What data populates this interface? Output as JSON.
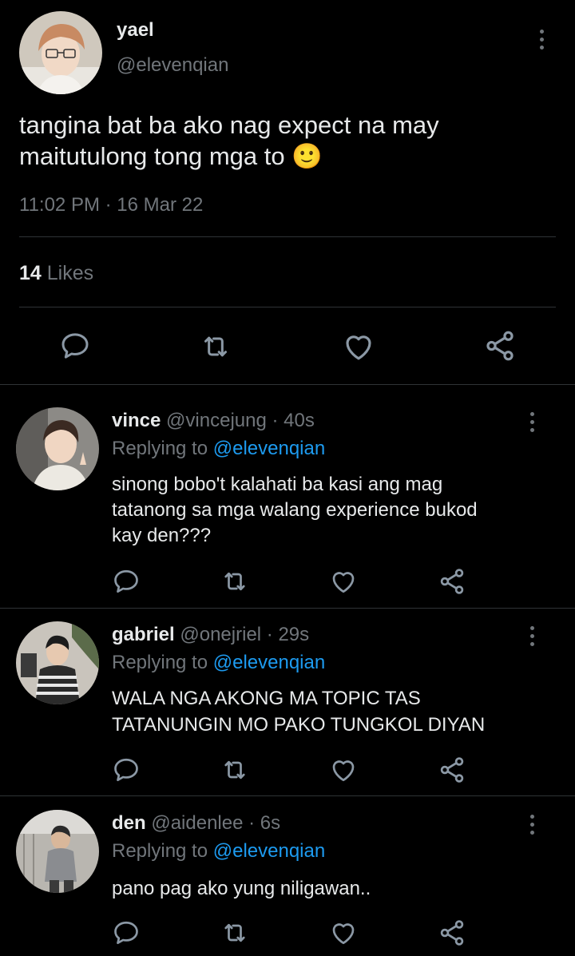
{
  "main_tweet": {
    "display_name": "yael",
    "handle": "@elevenqian",
    "text": "tangina bat ba ako nag expect na may maitutulong tong mga to 🙂",
    "time": "11:02 PM",
    "separator": "·",
    "date": "16 Mar 22",
    "likes_count": "14",
    "likes_label": "Likes",
    "avatar_icon": "avatar-photo-icon"
  },
  "replies": [
    {
      "display_name": "vince",
      "handle": "@vincejung",
      "age": "· 40s",
      "replying_prefix": "Replying to",
      "replying_handle": "@elevenqian",
      "text_lines": [
        "sinong bobo't kalahati ba kasi ang mag",
        "tatanong sa mga walang experience bukod",
        "kay den???"
      ]
    },
    {
      "display_name": "gabriel",
      "handle": "@onejriel",
      "age": "· 29s",
      "replying_prefix": "Replying to",
      "replying_handle": "@elevenqian",
      "text_lines": [
        "WALA NGA AKONG MA TOPIC TAS",
        "TATANUNGIN MO PAKO TUNGKOL DIYAN"
      ]
    },
    {
      "display_name": "den",
      "handle": "@aidenlee",
      "age": "· 6s",
      "replying_prefix": "Replying to",
      "replying_handle": "@elevenqian",
      "text_lines": [
        "pano pag ako yung niligawan.."
      ]
    }
  ],
  "actions": [
    "reply-icon",
    "retweet-icon",
    "like-icon",
    "share-icon"
  ],
  "colors": {
    "background": "#000000",
    "text": "#e7e9ea",
    "secondary": "#71767b",
    "link": "#1d9bf0",
    "divider": "#2f3336"
  }
}
